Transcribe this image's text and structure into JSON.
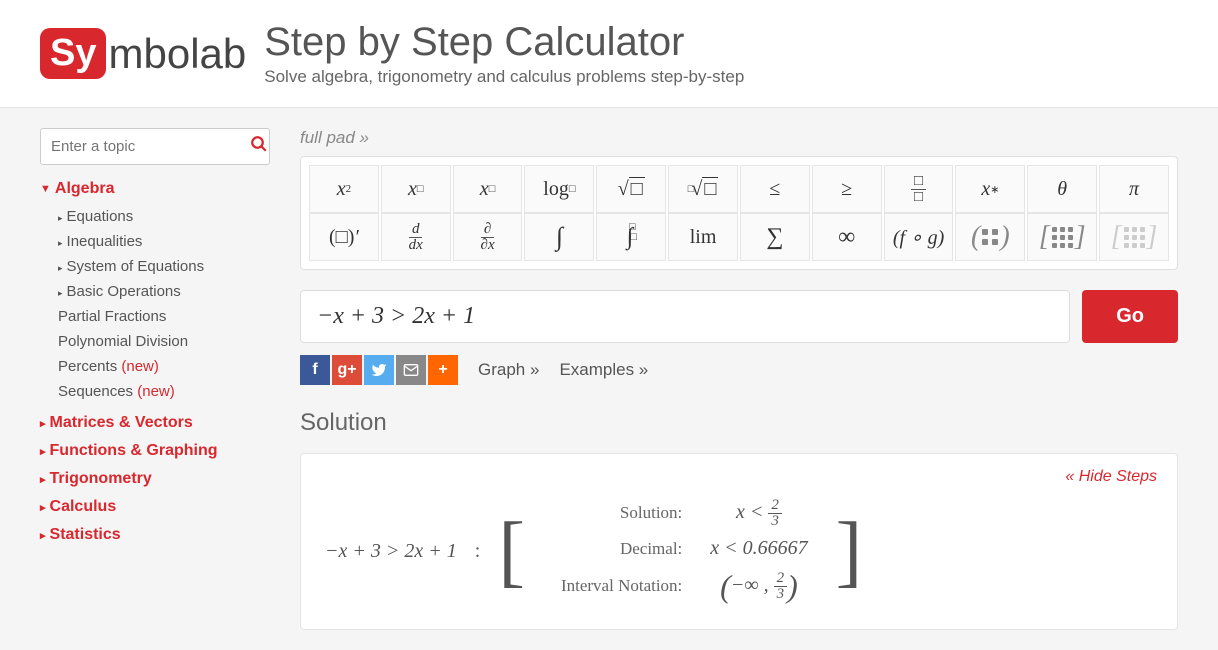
{
  "header": {
    "logo_prefix": "Sy",
    "logo_suffix": "mbolab",
    "title": "Step by Step Calculator",
    "subtitle": "Solve algebra, trigonometry and calculus problems step-by-step"
  },
  "search": {
    "placeholder": "Enter a topic"
  },
  "nav": {
    "algebra": {
      "label": "Algebra",
      "items": [
        {
          "label": "Equations",
          "caret": true
        },
        {
          "label": "Inequalities",
          "caret": true
        },
        {
          "label": "System of Equations",
          "caret": true
        },
        {
          "label": "Basic Operations",
          "caret": true
        },
        {
          "label": "Partial Fractions",
          "caret": false
        },
        {
          "label": "Polynomial Division",
          "caret": false
        },
        {
          "label": "Percents",
          "caret": false,
          "new": "(new)"
        },
        {
          "label": "Sequences",
          "caret": false,
          "new": "(new)"
        }
      ]
    },
    "cats": [
      "Matrices & Vectors",
      "Functions & Graphing",
      "Trigonometry",
      "Calculus",
      "Statistics"
    ]
  },
  "fullpad": "full pad »",
  "input": {
    "equation": "−x + 3 >  2x + 1"
  },
  "go": "Go",
  "links": {
    "graph": "Graph »",
    "examples": "Examples »"
  },
  "solution_heading": "Solution",
  "hide_steps": "« Hide Steps",
  "solution": {
    "problem": "−x + 3 > 2x + 1",
    "rows": [
      {
        "label": "Solution:",
        "value_html": "x < 2/3"
      },
      {
        "label": "Decimal:",
        "value": "x < 0.66667"
      },
      {
        "label": "Interval Notation:",
        "value_html": "(−∞, 2/3)"
      }
    ]
  },
  "pad_row1": [
    "x²",
    "xⁿ",
    "xₙ",
    "logₙ",
    "√□",
    "ⁿ√□",
    "≤",
    "≥",
    "□/□",
    "x*",
    "θ",
    "π"
  ],
  "pad_row2": [
    "(□)'",
    "d/dx",
    "∂/∂x",
    "∫",
    "∫ₐᵇ",
    "lim",
    "∑",
    "∞",
    "(f∘g)",
    "[2x2]",
    "[3x3]",
    "[nxm]"
  ]
}
